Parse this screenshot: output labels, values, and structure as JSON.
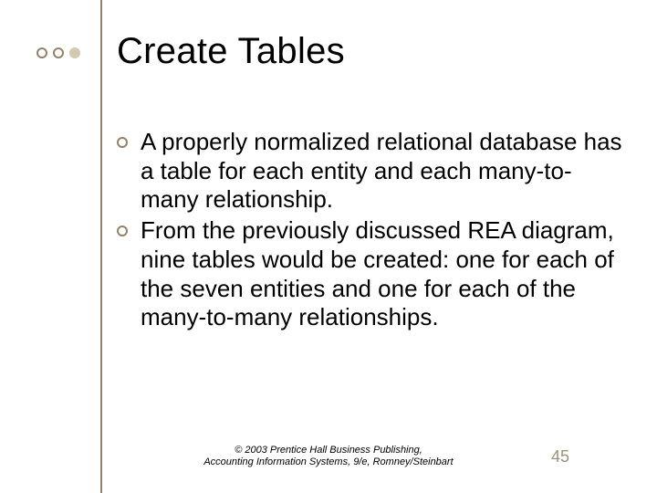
{
  "title": "Create Tables",
  "bullets": [
    {
      "text": "A properly normalized relational database has a table for each entity and each many-to-many relationship."
    },
    {
      "text": "From the previously discussed REA diagram, nine tables would be created: one for each of the seven entities and one for each of the many-to-many relationships."
    }
  ],
  "footer": {
    "line1": "© 2003 Prentice Hall Business Publishing,",
    "line2": "Accounting Information Systems, 9/e, Romney/Steinbart"
  },
  "page_number": "45"
}
